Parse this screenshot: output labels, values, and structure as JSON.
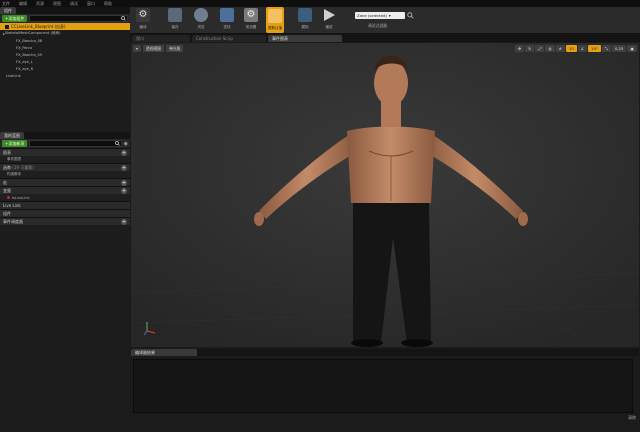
{
  "menu": [
    "文件",
    "编辑",
    "资源",
    "视图",
    "调试",
    "窗口",
    "帮助"
  ],
  "components": {
    "tab_label": "组件",
    "add_label": "+添加组件",
    "selected": "CCLiveLink_Blueprint (自身)",
    "tree": [
      "SkeletalMeshComponent (继承)",
      "FX_Baocha_08",
      "FX_Parca",
      "FX_Baocha_09",
      "FX_eye_L",
      "FX_eye_R",
      "LiveLink"
    ]
  },
  "mybp": {
    "tab_label": "我的蓝图",
    "add_label": "+添加新项",
    "sections": [
      {
        "label": "图表",
        "items": [
          "事件图表"
        ]
      },
      {
        "label": "函数",
        "sub": "(19 可重载)",
        "items": [
          "构造脚本"
        ]
      },
      {
        "label": "宏",
        "items": []
      },
      {
        "label": "变量",
        "items": [
          "IsLiveLink"
        ]
      },
      {
        "label": "Live Link",
        "items": []
      },
      {
        "label": "组件",
        "items": []
      },
      {
        "label": "事件调度器",
        "items": []
      }
    ]
  },
  "toolbar": {
    "buttons": [
      "编译",
      "保存",
      "浏览",
      "查找",
      "类设置",
      "类默认值",
      "模拟",
      "播放"
    ],
    "dropdown": "Zane (selected)",
    "debug_label": "调试过滤器"
  },
  "viewport": {
    "tabs": [
      "视口",
      "Construction Scrip",
      "事件图表"
    ],
    "perspective": "透视视图",
    "lit": "带光照",
    "zoom": "0.25"
  },
  "compiler": {
    "tab_label": "编译器结果",
    "footer": "清除"
  },
  "colors": {
    "accent": "#e3a011",
    "add_green": "#3c8a24",
    "skin": "#b37a5a"
  }
}
